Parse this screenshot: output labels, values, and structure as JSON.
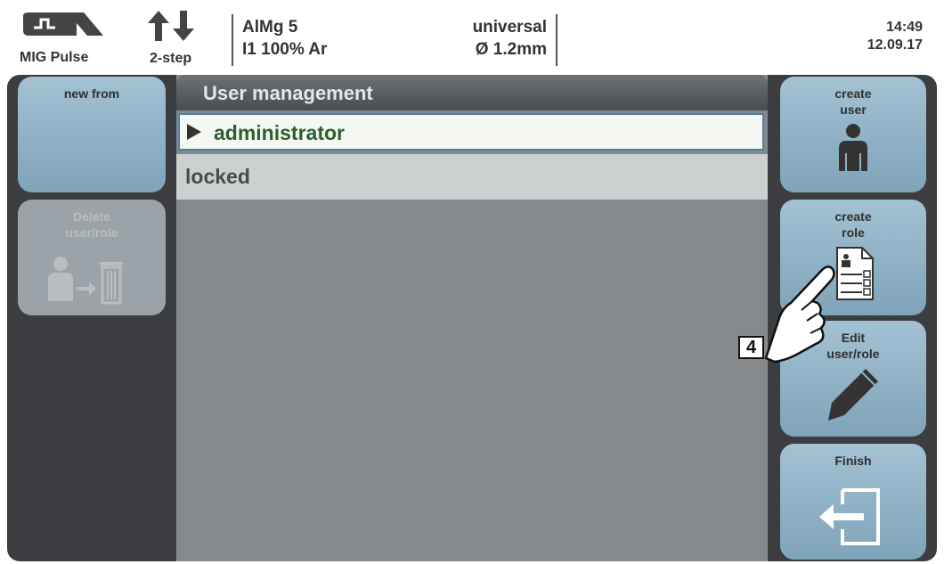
{
  "status": {
    "mode_label": "MIG Pulse",
    "mode_icon": "mig-pulse-icon",
    "step_label": "2-step",
    "step_icon": "up-down-arrows-icon",
    "material_line1": "AlMg 5",
    "material_line2": "I1 100% Ar",
    "wire_line1": "universal",
    "wire_line2": "Ø  1.2mm",
    "time": "14:49",
    "date": "12.09.17"
  },
  "left_keys": {
    "new_from": {
      "label": "new from",
      "enabled": true
    },
    "delete": {
      "label_1": "Delete",
      "label_2": "user/role",
      "enabled": false,
      "icon": "user-to-trash-icon"
    }
  },
  "list": {
    "title": "User management",
    "items": [
      {
        "label": "administrator",
        "selected": true
      },
      {
        "label": "locked",
        "selected": false
      }
    ]
  },
  "right_keys": {
    "create_user": {
      "label_1": "create",
      "label_2": "user",
      "icon": "user-icon"
    },
    "create_role": {
      "label_1": "create",
      "label_2": "role",
      "icon": "role-document-icon"
    },
    "edit": {
      "label_1": "Edit",
      "label_2": "user/role",
      "icon": "pencil-icon"
    },
    "finish": {
      "label": "Finish",
      "icon": "exit-door-icon"
    }
  },
  "callout": {
    "step_number": "4"
  },
  "colors": {
    "softkey": "#8fb1c5",
    "panel": "#3b3d40",
    "list_bg": "#868a8d",
    "selected_text": "#2e5e2e"
  }
}
